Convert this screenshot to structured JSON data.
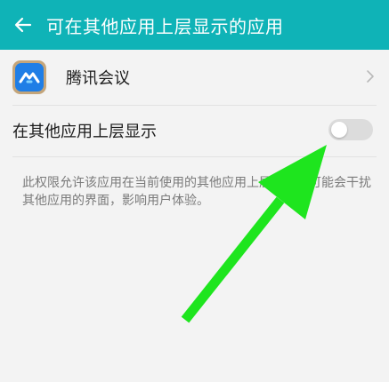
{
  "header": {
    "title": "可在其他应用上层显示的应用",
    "background_color": "#0fb3b7",
    "back_icon": "arrow-left-icon"
  },
  "app_row": {
    "name": "腾讯会议",
    "icon": "tencent-meeting-icon",
    "chevron_icon": "chevron-right-icon"
  },
  "toggle_row": {
    "label": "在其他应用上层显示",
    "state": "off"
  },
  "description": {
    "text": "此权限允许该应用在当前使用的其他应用上层显示，可能会干扰其他应用的界面，影响用户体验。"
  },
  "annotation": {
    "icon": "green-arrow-icon",
    "color": "#1ee51e"
  }
}
